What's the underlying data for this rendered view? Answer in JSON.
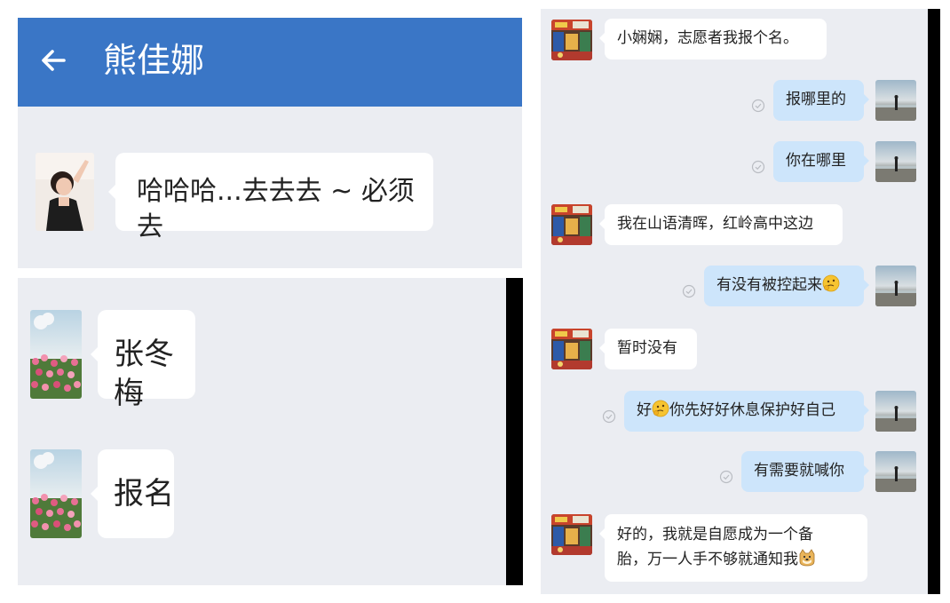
{
  "screen1": {
    "header": {
      "title": "熊佳娜"
    },
    "message": {
      "text": "哈哈哈...去去去 ~ 必须去"
    }
  },
  "screen2": {
    "messages": [
      {
        "text": "张冬梅"
      },
      {
        "text": "报名"
      }
    ]
  },
  "screen3": {
    "messages": [
      {
        "side": "left",
        "text": "小娴娴，志愿者我报个名。"
      },
      {
        "side": "right",
        "text": "报哪里的"
      },
      {
        "side": "right",
        "text": "你在哪里"
      },
      {
        "side": "left",
        "text": "我在山语清晖，红岭高中这边"
      },
      {
        "side": "right",
        "text": "有没有被控起来",
        "emoji": "thinking-emoji"
      },
      {
        "side": "left",
        "text": "暂时没有"
      },
      {
        "side": "right",
        "text_before": "好",
        "emoji": "thinking-emoji",
        "text_after": "你先好好休息保护好自己"
      },
      {
        "side": "right",
        "text": "有需要就喊你"
      },
      {
        "side": "left",
        "line1": "好的，我就是自愿成为一个备",
        "line2": "胎，万一人手不够就通知我",
        "emoji": "doge-emoji"
      }
    ]
  },
  "colors": {
    "header_blue": "#3a76c6",
    "chat_bg": "#ebedf2",
    "sent_bubble": "#cde5fb",
    "received_bubble": "#ffffff"
  }
}
